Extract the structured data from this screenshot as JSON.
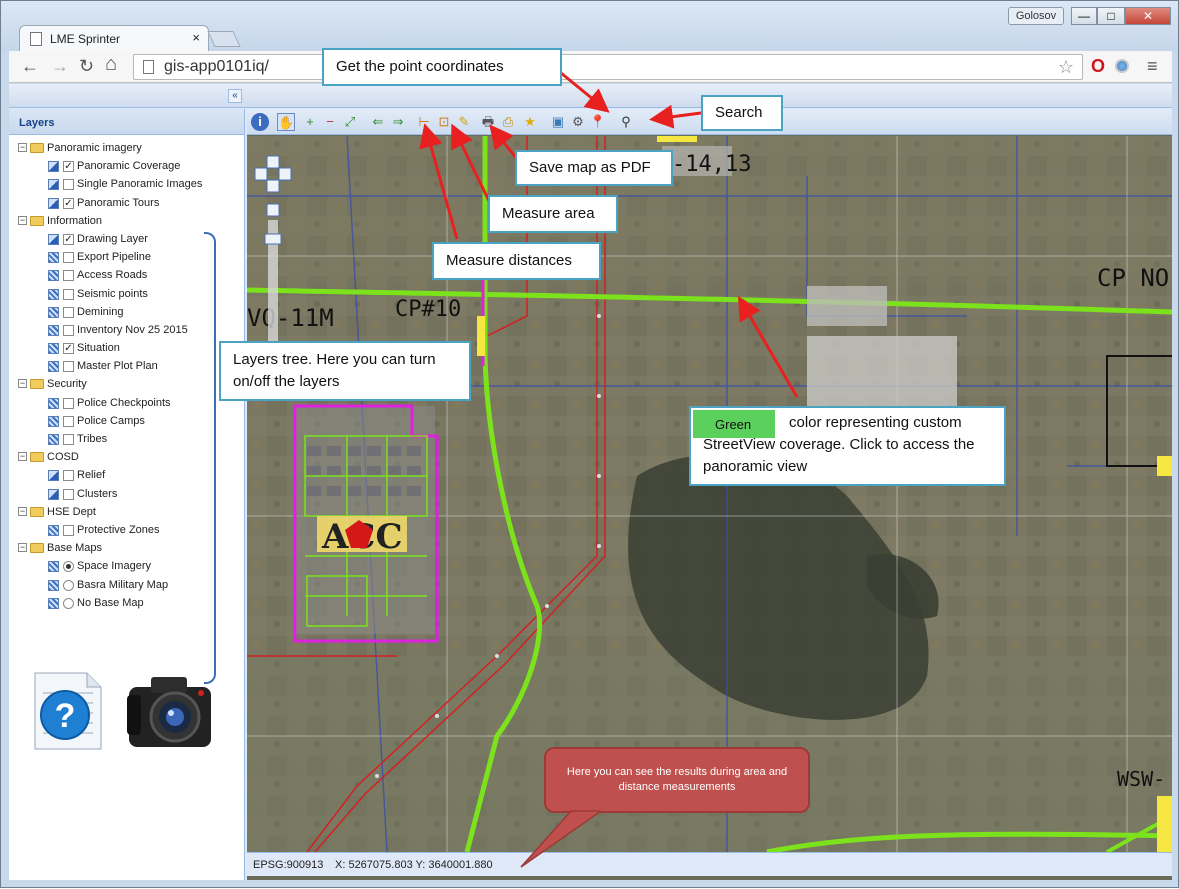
{
  "browser": {
    "tab_title": "LME Sprinter",
    "tab_close": "×",
    "user": "Golosov",
    "url": "gis-app0101iq/",
    "min": "—",
    "max": "□",
    "close": "✕",
    "back": "←",
    "forward": "→",
    "reload": "↻",
    "home": "⌂"
  },
  "panel": {
    "title": "Layers",
    "collapse": "«"
  },
  "tree": [
    {
      "type": "group",
      "label": "Panoramic imagery"
    },
    {
      "type": "item",
      "label": "Panoramic Coverage",
      "checked": true,
      "icon": "pen"
    },
    {
      "type": "item",
      "label": "Single Panoramic Images",
      "checked": false,
      "icon": "pen"
    },
    {
      "type": "item",
      "label": "Panoramic Tours",
      "checked": true,
      "icon": "pen"
    },
    {
      "type": "group",
      "label": "Information"
    },
    {
      "type": "item",
      "label": "Drawing Layer",
      "checked": true,
      "icon": "pen"
    },
    {
      "type": "item",
      "label": "Export Pipeline",
      "checked": false,
      "icon": "grid"
    },
    {
      "type": "item",
      "label": "Access Roads",
      "checked": false,
      "icon": "grid"
    },
    {
      "type": "item",
      "label": "Seismic points",
      "checked": false,
      "icon": "grid"
    },
    {
      "type": "item",
      "label": "Demining",
      "checked": false,
      "icon": "grid"
    },
    {
      "type": "item",
      "label": "Inventory Nov 25 2015",
      "checked": false,
      "icon": "grid"
    },
    {
      "type": "item",
      "label": "Situation",
      "checked": true,
      "icon": "grid"
    },
    {
      "type": "item",
      "label": "Master Plot Plan",
      "checked": false,
      "icon": "grid"
    },
    {
      "type": "group",
      "label": "Security"
    },
    {
      "type": "item",
      "label": "Police Checkpoints",
      "checked": false,
      "icon": "grid"
    },
    {
      "type": "item",
      "label": "Police Camps",
      "checked": false,
      "icon": "grid"
    },
    {
      "type": "item",
      "label": "Tribes",
      "checked": false,
      "icon": "grid"
    },
    {
      "type": "group",
      "label": "COSD"
    },
    {
      "type": "item",
      "label": "Relief",
      "checked": false,
      "icon": "pen"
    },
    {
      "type": "item",
      "label": "Clusters",
      "checked": false,
      "icon": "pen"
    },
    {
      "type": "group",
      "label": "HSE Dept"
    },
    {
      "type": "item",
      "label": "Protective Zones",
      "checked": false,
      "icon": "grid"
    },
    {
      "type": "group",
      "label": "Base Maps"
    },
    {
      "type": "radio",
      "label": "Space Imagery",
      "checked": true,
      "icon": "grid"
    },
    {
      "type": "radio",
      "label": "Basra Military Map",
      "checked": false,
      "icon": "grid"
    },
    {
      "type": "radio",
      "label": "No Base Map",
      "checked": false,
      "icon": "grid"
    }
  ],
  "map_labels": {
    "cp10": "CP#10",
    "wq11m": "VQ-11M",
    "cpno": "CP NO",
    "k14": "-14,13",
    "acc": "ACC",
    "wsw": "WSW-"
  },
  "status": {
    "epsg": "EPSG:900913",
    "coords": "X: 5267075.803 Y: 3640001.880"
  },
  "callouts": {
    "coords": "Get the point coordinates",
    "search": "Search",
    "pdf": "Save map as PDF",
    "area": "Measure area",
    "dist": "Measure distances",
    "layers": "Layers tree. Here you can turn on/off the layers",
    "green_tag": "Green",
    "green": "color representing custom StreetView coverage. Click to access the panoramic view",
    "results": "Here you can see the results during area and distance measurements"
  },
  "colors": {
    "accent": "#4aa3c2",
    "arrow": "#e82020",
    "green_line": "#7be21b",
    "magenta": "#e020e0"
  }
}
